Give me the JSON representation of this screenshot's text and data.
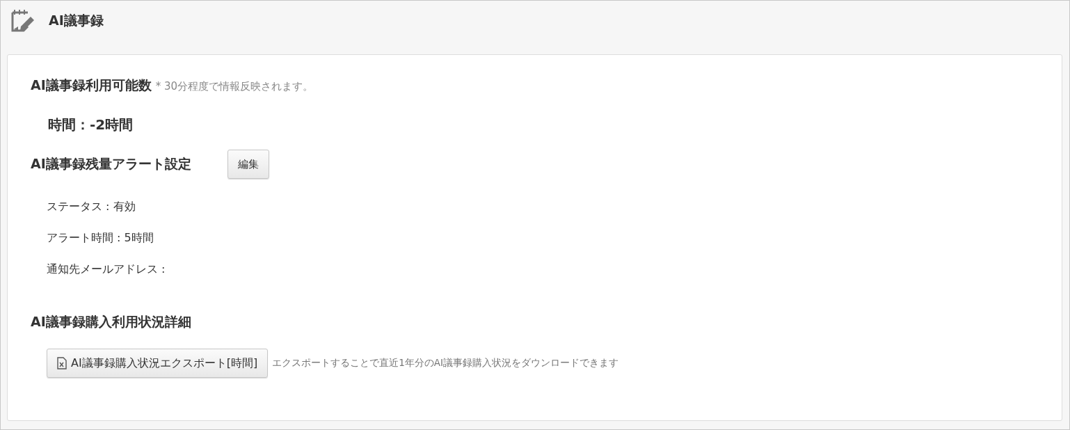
{
  "header": {
    "title": "AI議事録"
  },
  "availability": {
    "heading": "AI議事録利用可能数",
    "note": "* 30分程度で情報反映されます。",
    "amount": "時間：-2時間"
  },
  "alert_settings": {
    "heading": "AI議事録残量アラート設定",
    "edit_button": "編集",
    "details": [
      "ステータス : 有効",
      "アラート時間 : 5時間",
      "通知先メールアドレス :"
    ]
  },
  "purchase_details": {
    "heading": "AI議事録購入利用状況詳細",
    "export_button": "AI議事録購入状況エクスポート[時間]",
    "export_note": "エクスポートすることで直近1年分のAI議事録購入状況をダウンロードできます"
  }
}
